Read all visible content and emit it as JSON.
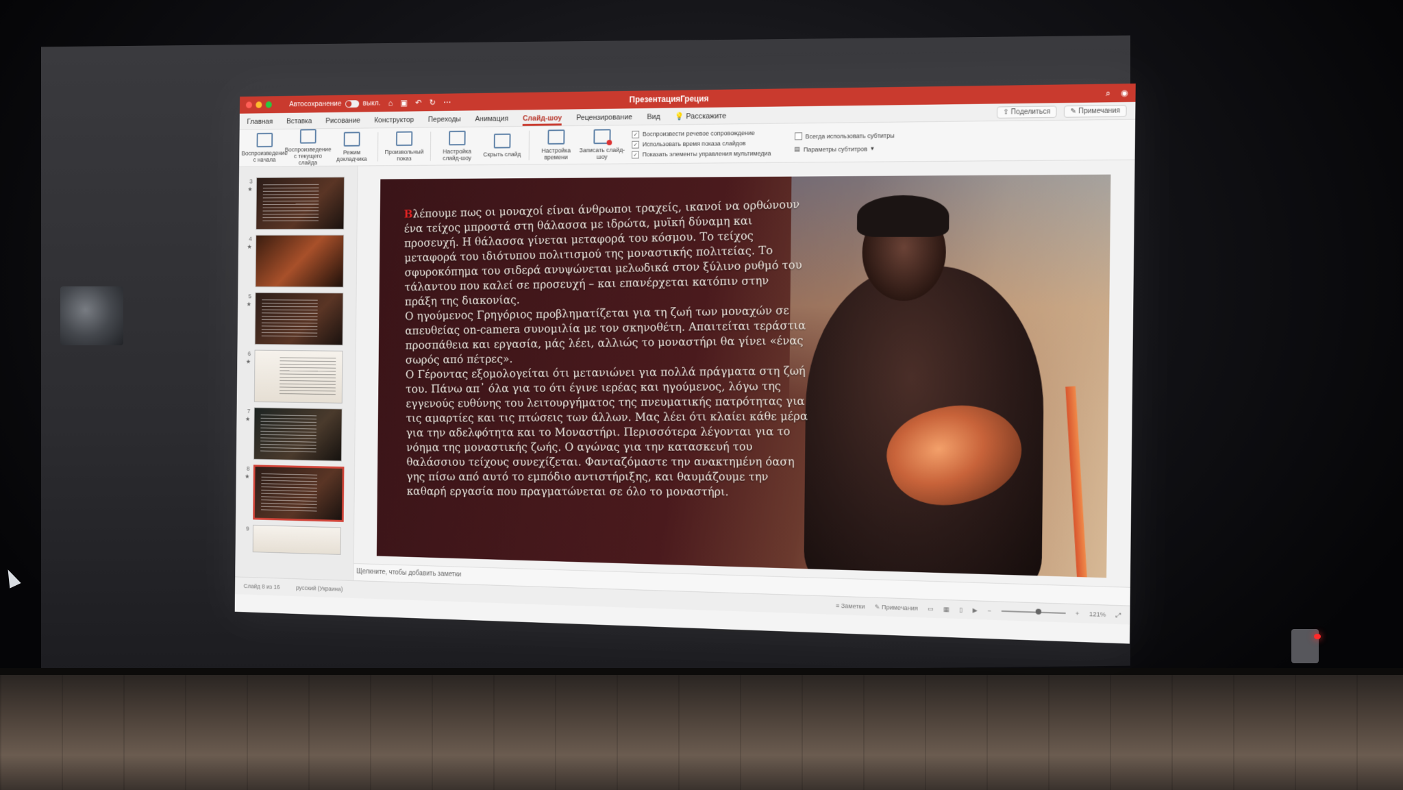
{
  "window": {
    "title": "ПрезентацияГреция",
    "autosave_label": "Автосохранение",
    "autosave_state": "выкл."
  },
  "tabs": [
    "Главная",
    "Вставка",
    "Рисование",
    "Конструктор",
    "Переходы",
    "Анимация",
    "Слайд-шоу",
    "Рецензирование",
    "Вид"
  ],
  "active_tab": "Слайд-шоу",
  "tell_me": "Расскажите",
  "share_label": "Поделиться",
  "comments_label": "Примечания",
  "ribbon": {
    "buttons": [
      {
        "label": "Воспроизведение с начала"
      },
      {
        "label": "Воспроизведение с текущего слайда"
      },
      {
        "label": "Режим докладчика"
      },
      {
        "label": "Произвольный показ"
      },
      {
        "label": "Настройка слайд-шоу"
      },
      {
        "label": "Скрыть слайд"
      },
      {
        "label": "Настройка времени"
      },
      {
        "label": "Записать слайд-шоу"
      }
    ],
    "checks": [
      {
        "label": "Воспроизвести речевое сопровождение",
        "checked": true
      },
      {
        "label": "Использовать время показа слайдов",
        "checked": true
      },
      {
        "label": "Показать элементы управления мультимедиа",
        "checked": true
      }
    ],
    "subtitles_always": "Всегда использовать субтитры",
    "subtitle_params": "Параметры субтитров"
  },
  "thumbnails": [
    {
      "num": "3",
      "style": "dark"
    },
    {
      "num": "4",
      "style": "fire"
    },
    {
      "num": "5",
      "style": "dark"
    },
    {
      "num": "6",
      "style": "light"
    },
    {
      "num": "7",
      "style": "green"
    },
    {
      "num": "8",
      "style": "dark",
      "selected": true
    },
    {
      "num": "9",
      "style": "light"
    }
  ],
  "slide": {
    "dropcap": "Β",
    "paragraph1": "λέπουμε πως οι μοναχοί είναι άνθρωποι τραχείς, ικανοί να ορθώνουν ένα τείχος μπροστά στη θάλασσα με ιδρώτα, μυϊκή δύναμη και προσευχή. Η θάλασσα γίνεται μεταφορά του κόσμου. Το τείχος μεταφορά του ιδιότυπου πολιτισμού της μοναστικής πολιτείας. Το σφυροκόπημα του σιδερά ανυψώνεται μελωδικά στον ξύλινο ρυθμό του τάλαντου που καλεί σε προσευχή – και επανέρχεται κατόπιν στην πράξη της διακονίας.",
    "paragraph2": "Ο ηγούμενος Γρηγόριος προβληματίζεται για τη ζωή των μοναχών σε απευθείας on-camera συνομιλία με τον σκηνοθέτη. Απαιτείται τεράστια προσπάθεια και εργασία, μάς λέει, αλλιώς το μοναστήρι θα γίνει «ένας σωρός από πέτρες».",
    "paragraph3": "Ο Γέροντας εξομολογείται ότι μετανιώνει για πολλά πράγματα στη ζωή του. Πάνω απ᾽ όλα για το ότι έγινε ιερέας και ηγούμενος, λόγω της εγγενούς ευθύνης του λειτουργήματος της πνευματικής πατρότητας για τις αμαρτίες και τις πτώσεις των άλλων. Μας λέει ότι κλαίει κάθε μέρα για την αδελφότητα και το Μοναστήρι. Περισσότερα λέγονται για το νόημα της μοναστικής ζωής. Ο αγώνας για την κατασκευή του θαλάσσιου τείχους συνεχίζεται. Φανταζόμαστε την ανακτημένη όαση γης πίσω από αυτό το εμπόδιο αντιστήριξης, και θαυμάζουμε την καθαρή εργασία που πραγματώνεται σε όλο το μοναστήρι."
  },
  "notes_placeholder": "Щелкните, чтобы добавить заметки",
  "status": {
    "slide_counter": "Слайд 8 из 16",
    "language": "русский (Украина)",
    "notes": "Заметки",
    "comments": "Примечания",
    "zoom": "121%"
  },
  "colors": {
    "accent": "#c93a2e",
    "dropcap": "#e02424"
  }
}
